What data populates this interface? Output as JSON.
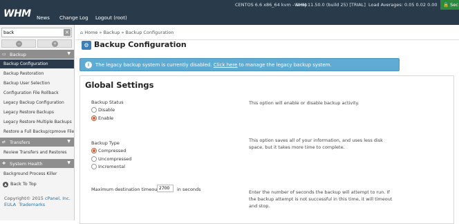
{
  "topbar": {
    "logo": "WHM",
    "nav": [
      "News",
      "Change Log",
      "Logout (root)"
    ],
    "os": "CENTOS 6.6 x86_64 kvm – lamp",
    "version": "WHM 11.50.0 (build 25) [TRIAL]",
    "load": "Load Averages: 0.05 0.02 0.00",
    "secure": "Sec"
  },
  "sidebar": {
    "search_value": "back",
    "backup_section": {
      "label": "Backup",
      "items": [
        "Backup Configuration",
        "Backup Restoration",
        "Backup User Selection",
        "Configuration File Rollback",
        "Legacy Backup Configuration",
        "Legacy Restore Backups",
        "Legacy Restore Multiple Backups",
        "Restore a Full Backup/cpmove File"
      ]
    },
    "transfers_section": {
      "label": "Transfers",
      "items": [
        "Review Transfers and Restores"
      ]
    },
    "health_section": {
      "label": "System Health",
      "items": [
        "Background Process Killer"
      ]
    },
    "back_to_top": "Back To Top",
    "copyright": "Copyright© 2015",
    "cpanel": "cPanel, Inc.",
    "eula": "EULA",
    "trademarks": "Trademarks"
  },
  "breadcrumb": {
    "home": "Home",
    "sep": "»",
    "section": "Backup",
    "current": "Backup Configuration"
  },
  "page_title": "Backup Configuration",
  "alert": {
    "before": "The legacy backup system is currently disabled.",
    "link": "Click here",
    "after": "to manage the legacy backup system."
  },
  "settings": {
    "title": "Global Settings",
    "status": {
      "label": "Backup Status",
      "options": [
        "Disable",
        "Enable"
      ],
      "selected": "Enable",
      "desc": "This option will enable or disable backup activity."
    },
    "type": {
      "label": "Backup Type",
      "options": [
        "Compressed",
        "Uncompressed",
        "Incremental"
      ],
      "selected": "Compressed",
      "desc": "This option saves all of your information, and uses less disk space, but it takes more time to complete."
    },
    "timeout": {
      "label": "Maximum destination timeout",
      "value": "2700",
      "unit": "in seconds",
      "desc": "Enter the number of seconds the backup will attempt to run. If the backup attempt is not successful in this time, it will timeout and stop."
    }
  }
}
